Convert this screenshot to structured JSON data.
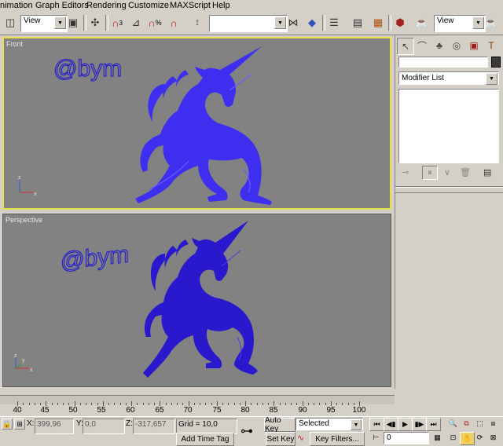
{
  "menu": [
    "nimation",
    "Graph Editors",
    "Rendering",
    "Customize",
    "MAXScript",
    "Help"
  ],
  "toolbar": {
    "view_select": "View",
    "right_view_select": "View",
    "selection_set": "",
    "percent_label": "%",
    "angle_label": "3"
  },
  "viewports": {
    "front": {
      "label": "Front",
      "text3d": "@bym"
    },
    "perspective": {
      "label": "Perspective",
      "text3d": "@bym"
    },
    "axis": {
      "x": "x",
      "y": "y",
      "z": "z"
    }
  },
  "command_panel": {
    "name_field": "",
    "modifier_list": "Modifier List"
  },
  "timeline": {
    "ticks": [
      "40",
      "45",
      "50",
      "55",
      "60",
      "65",
      "70",
      "75",
      "80",
      "85",
      "90",
      "95",
      "100"
    ]
  },
  "status": {
    "x_label": "X:",
    "x_value": "399,96",
    "y_label": "Y:",
    "y_value": "0,0",
    "z_label": "Z:",
    "z_value": "-317,657",
    "grid": "Grid = 10,0",
    "add_time_tag": "Add Time Tag",
    "auto_key": "Auto Key",
    "selected": "Selected",
    "set_key": "Set Key",
    "key_filters": "Key Filters...",
    "frame_value": "0"
  },
  "colors": {
    "front_unicorn": "#3e2ef0",
    "persp_unicorn": "#2a18cc",
    "active_border": "#e8e04a",
    "viewport_bg": "#828282"
  }
}
